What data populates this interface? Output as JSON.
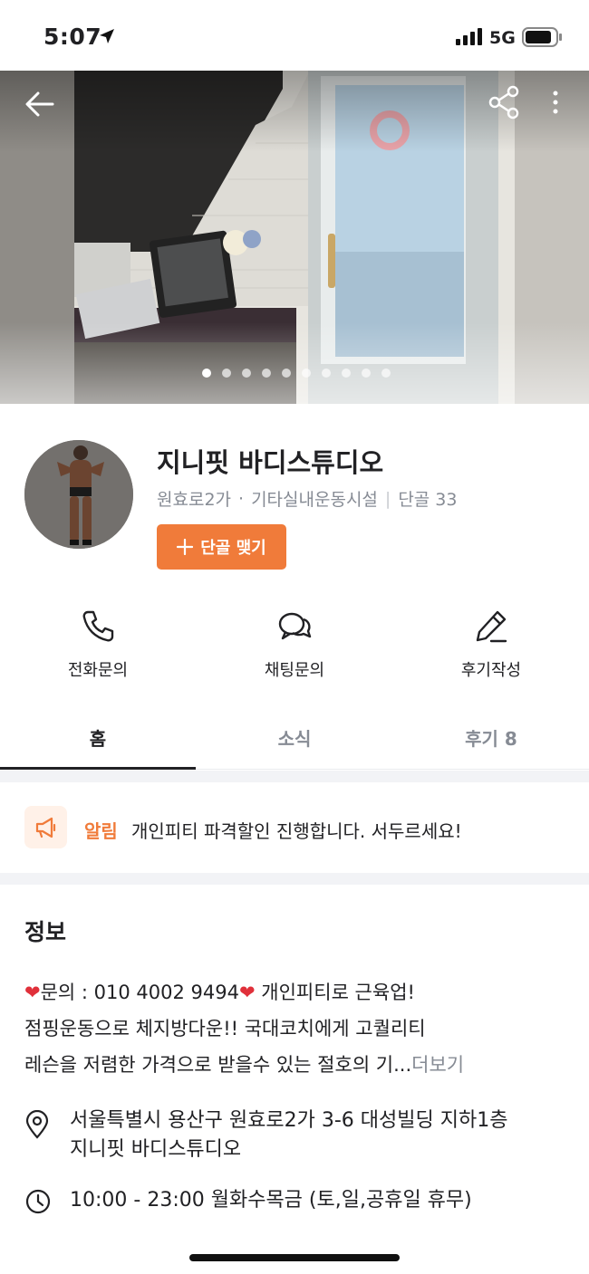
{
  "status_bar": {
    "time": "5:07",
    "network": "5G"
  },
  "hero": {
    "slide_count": 10,
    "active_slide": 1
  },
  "profile": {
    "name": "지니핏 바디스튜디오",
    "location": "원효로2가",
    "category": "기타실내운동시설",
    "regulars": "단골 33",
    "regular_button": "단골 맺기"
  },
  "actions": [
    {
      "label": "전화문의",
      "icon": "phone-icon"
    },
    {
      "label": "채팅문의",
      "icon": "chat-icon"
    },
    {
      "label": "후기작성",
      "icon": "pencil-icon"
    }
  ],
  "tabs": [
    {
      "label": "홈",
      "active": true
    },
    {
      "label": "소식",
      "active": false
    },
    {
      "label": "후기 8",
      "active": false
    }
  ],
  "notice": {
    "tag": "알림",
    "text": "개인피티 파격할인 진행합니다. 서두르세요!"
  },
  "info": {
    "title": "정보",
    "desc_line1": "문의 : 010 4002 9494",
    "desc_line1_after": " 개인피티로 근육업!",
    "desc_line2": "점핑운동으로 체지방다운!! 국대코치에게 고퀄리티",
    "desc_line3": "레슨을 저렴한 가격으로 받을수 있는 절호의 기...",
    "more_label": "더보기",
    "address_line1": "서울특별시 용산구 원효로2가 3-6 대성빌딩 지하1층",
    "address_line2": "지니핏 바디스튜디오",
    "hours": "10:00 - 23:00 월화수목금 (토,일,공휴일 휴무)"
  },
  "colors": {
    "accent": "#f07b3a",
    "muted": "#868b94",
    "text": "#212124"
  }
}
